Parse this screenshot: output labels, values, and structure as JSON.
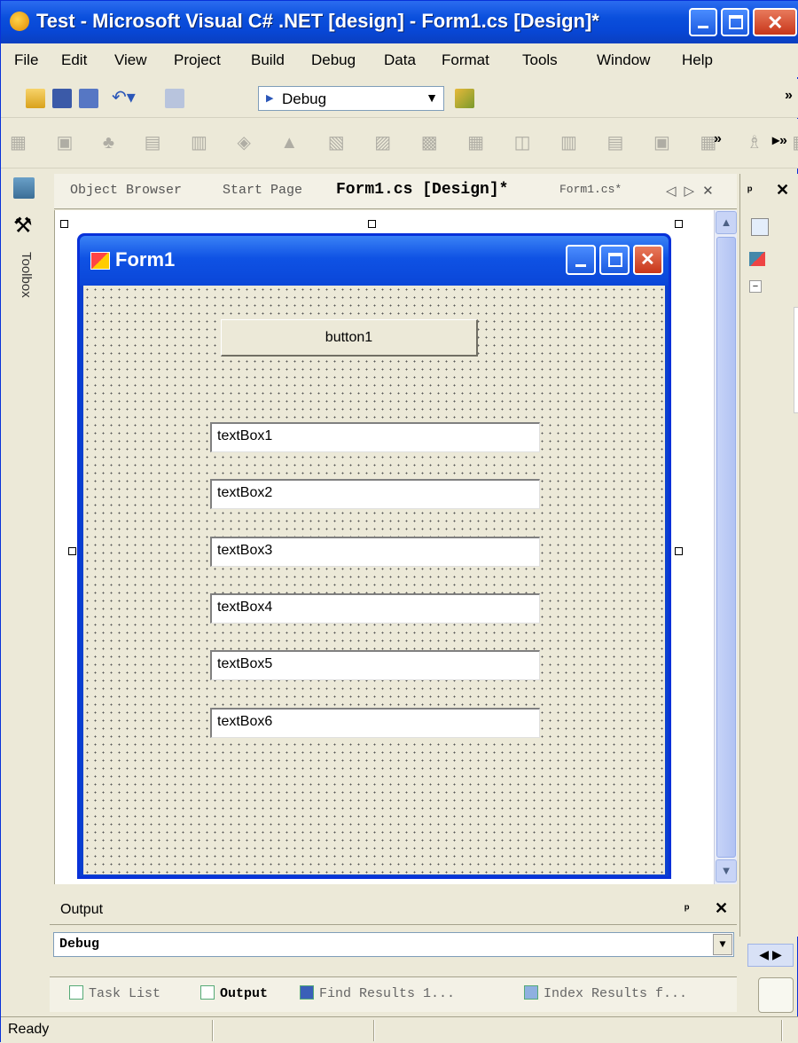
{
  "window": {
    "title": "Test - Microsoft Visual C# .NET [design] - Form1.cs [Design]*"
  },
  "menu": [
    "File",
    "Edit",
    "View",
    "Project",
    "Build",
    "Debug",
    "Data",
    "Format",
    "Tools",
    "Window",
    "Help"
  ],
  "toolbar": {
    "config_combo": "Debug",
    "overflow": "»"
  },
  "document_tabs": {
    "items": [
      "Object Browser",
      "Start Page",
      "Form1.cs [Design]*",
      "Form1.cs*"
    ],
    "active_index": 2,
    "nav": "◁ ▷ ✕"
  },
  "toolbox": {
    "label": "Toolbox"
  },
  "right_panel": {
    "pin": "ᵖ",
    "close": "✕"
  },
  "form": {
    "title": "Form1",
    "button_label": "button1",
    "textboxes": [
      "textBox1",
      "textBox2",
      "textBox3",
      "textBox4",
      "textBox5",
      "textBox6"
    ]
  },
  "output": {
    "title": "Output",
    "selected": "Debug"
  },
  "bottom_tabs": {
    "items": [
      "Task List",
      "Output",
      "Find Results 1...",
      "Index Results f..."
    ],
    "active_index": 1
  },
  "status": {
    "text": "Ready"
  },
  "colors": {
    "titlebar": "#0a4fdc",
    "form_border": "#0831d9",
    "surface": "#ece9d8"
  }
}
